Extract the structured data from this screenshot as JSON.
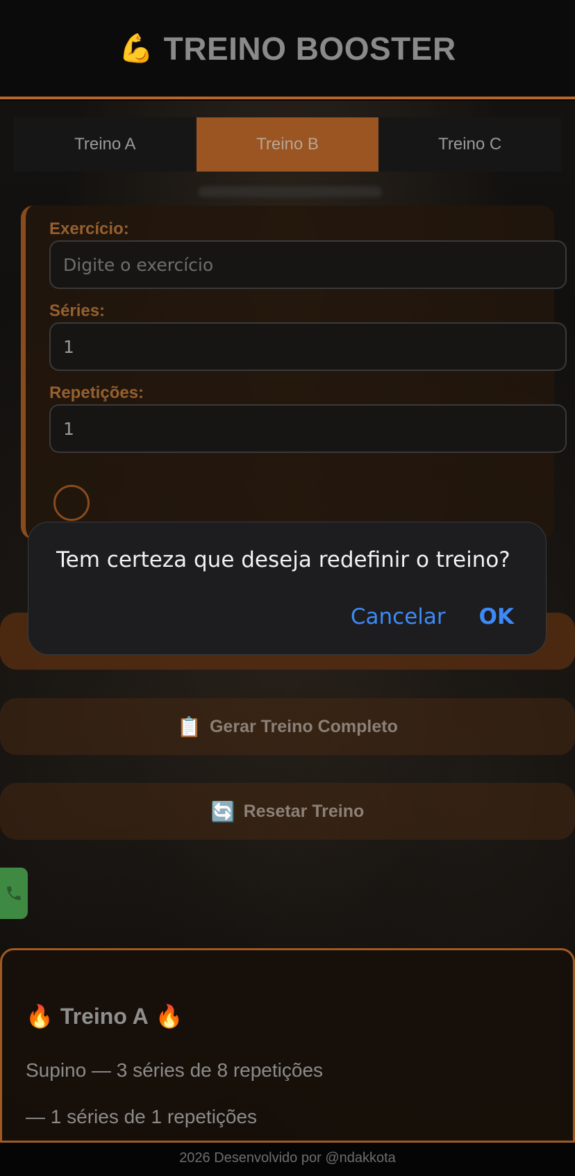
{
  "header": {
    "icon": "flexed-biceps-icon",
    "icon_glyph": "💪",
    "title": "TREINO BOOSTER"
  },
  "tabs": [
    {
      "label": "Treino A",
      "active": false
    },
    {
      "label": "Treino B",
      "active": true
    },
    {
      "label": "Treino C",
      "active": false
    }
  ],
  "form": {
    "exercise_label": "Exercício:",
    "exercise_placeholder": "Digite o exercício",
    "exercise_value": "",
    "series_label": "Séries:",
    "series_value": "1",
    "reps_label": "Repetições:",
    "reps_value": "1"
  },
  "buttons": {
    "generate_icon": "clipboard-icon",
    "generate_glyph": "📋",
    "generate_label": "Gerar Treino Completo",
    "reset_icon": "refresh-icon",
    "reset_glyph": "🔄",
    "reset_label": "Resetar Treino"
  },
  "summary": {
    "title": "Treino A",
    "title_icon": "fire-icon",
    "title_glyph": "🔥",
    "lines": [
      "Supino — 3 séries de 8 repetições",
      "— 1 séries de 1 repetições"
    ]
  },
  "footer": {
    "text": "2026 Desenvolvido por @ndakkota"
  },
  "dialog": {
    "message": "Tem certeza que deseja redefinir o treino?",
    "cancel_label": "Cancelar",
    "ok_label": "OK"
  },
  "colors": {
    "accent": "#b8662a",
    "dialog_button": "#3d8af7",
    "whatsapp": "#3f8a43"
  }
}
